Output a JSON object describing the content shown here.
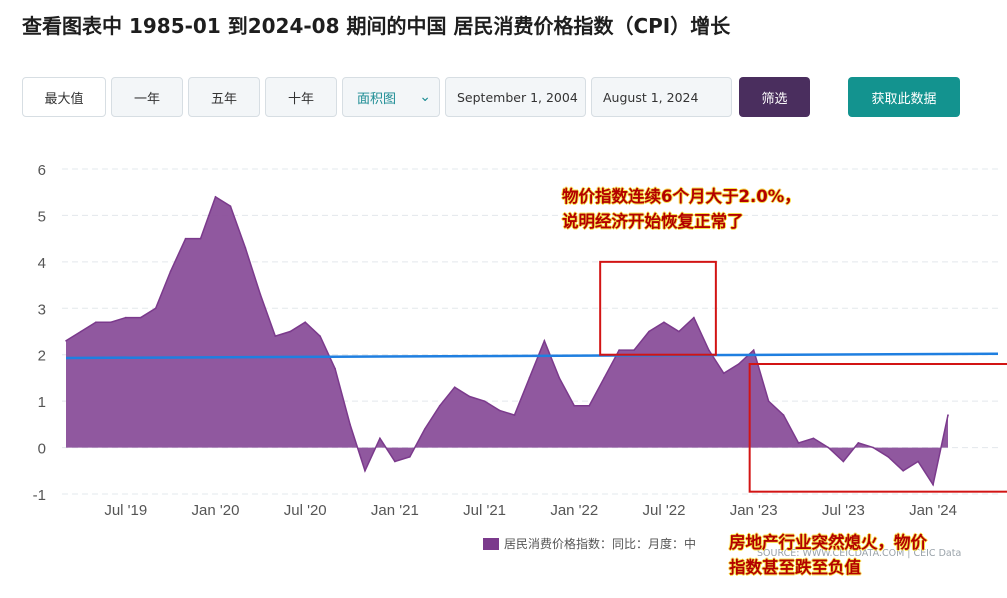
{
  "page": {
    "title": "查看图表中 1985-01 到2024-08 期间的中国 居民消费价格指数（CPI）增长"
  },
  "toolbar": {
    "buttons": [
      "最大值",
      "一年",
      "五年",
      "十年"
    ],
    "chart_type": "面积图",
    "start_date": "September 1, 2004",
    "end_date": "August 1, 2024",
    "filter_label": "筛选",
    "get_data_label": "获取此数据"
  },
  "annotations": {
    "top_line1": "物价指数连续6个月大于2.0%，",
    "top_line2": "说明经济开始恢复正常了",
    "bottom_line1": "房地产行业突然熄火，物价",
    "bottom_line2": "指数甚至跌至负值"
  },
  "legend": {
    "label": "居民消费价格指数：同比：月度：中"
  },
  "source": "SOURCE: WWW.CEICDATA.COM | CEIC Data",
  "colors": {
    "area_fill": "#8a4f9a",
    "area_stroke": "#7b3a8c",
    "trend_line": "#1f7fe0",
    "annotation_box": "#d21414",
    "annotation_text": "#b30000",
    "annotation_glow": "#f7e04a",
    "filter_button": "#4a2e5e",
    "get_data_button": "#13938f"
  },
  "chart_data": {
    "type": "area",
    "x_tick_labels": [
      "Jul '19",
      "Jan '20",
      "Jul '20",
      "Jan '21",
      "Jul '21",
      "Jan '22",
      "Jul '22",
      "Jan '23",
      "Jul '23",
      "Jan '24"
    ],
    "y_ticks": [
      6,
      5,
      4,
      3,
      2,
      1,
      0,
      -1
    ],
    "ylim": [
      -1,
      6
    ],
    "start_period": "2019-03",
    "end_period": "2024-08",
    "values": [
      2.3,
      2.5,
      2.7,
      2.7,
      2.8,
      2.8,
      3.0,
      3.8,
      4.5,
      4.5,
      5.4,
      5.2,
      4.3,
      3.3,
      2.4,
      2.5,
      2.7,
      2.4,
      1.7,
      0.5,
      -0.5,
      0.2,
      -0.3,
      -0.2,
      0.4,
      0.9,
      1.3,
      1.1,
      1.0,
      0.8,
      0.7,
      1.5,
      2.3,
      1.5,
      0.9,
      0.9,
      1.5,
      2.1,
      2.1,
      2.5,
      2.7,
      2.5,
      2.8,
      2.1,
      1.6,
      1.8,
      2.1,
      1.0,
      0.7,
      0.1,
      0.2,
      0.0,
      -0.3,
      0.1,
      0.0,
      -0.2,
      -0.5,
      -0.3,
      -0.8,
      0.7
    ],
    "trend_line": {
      "start": 1.93,
      "end": 2.02
    },
    "highlight_boxes": [
      {
        "from_period": "2022-03",
        "to_period": "2022-09",
        "y_from": 2.0,
        "y_to": 4.0
      },
      {
        "from_period": "2023-01",
        "to_period": "2024-08",
        "y_from": -0.95,
        "y_to": 1.8
      }
    ]
  }
}
